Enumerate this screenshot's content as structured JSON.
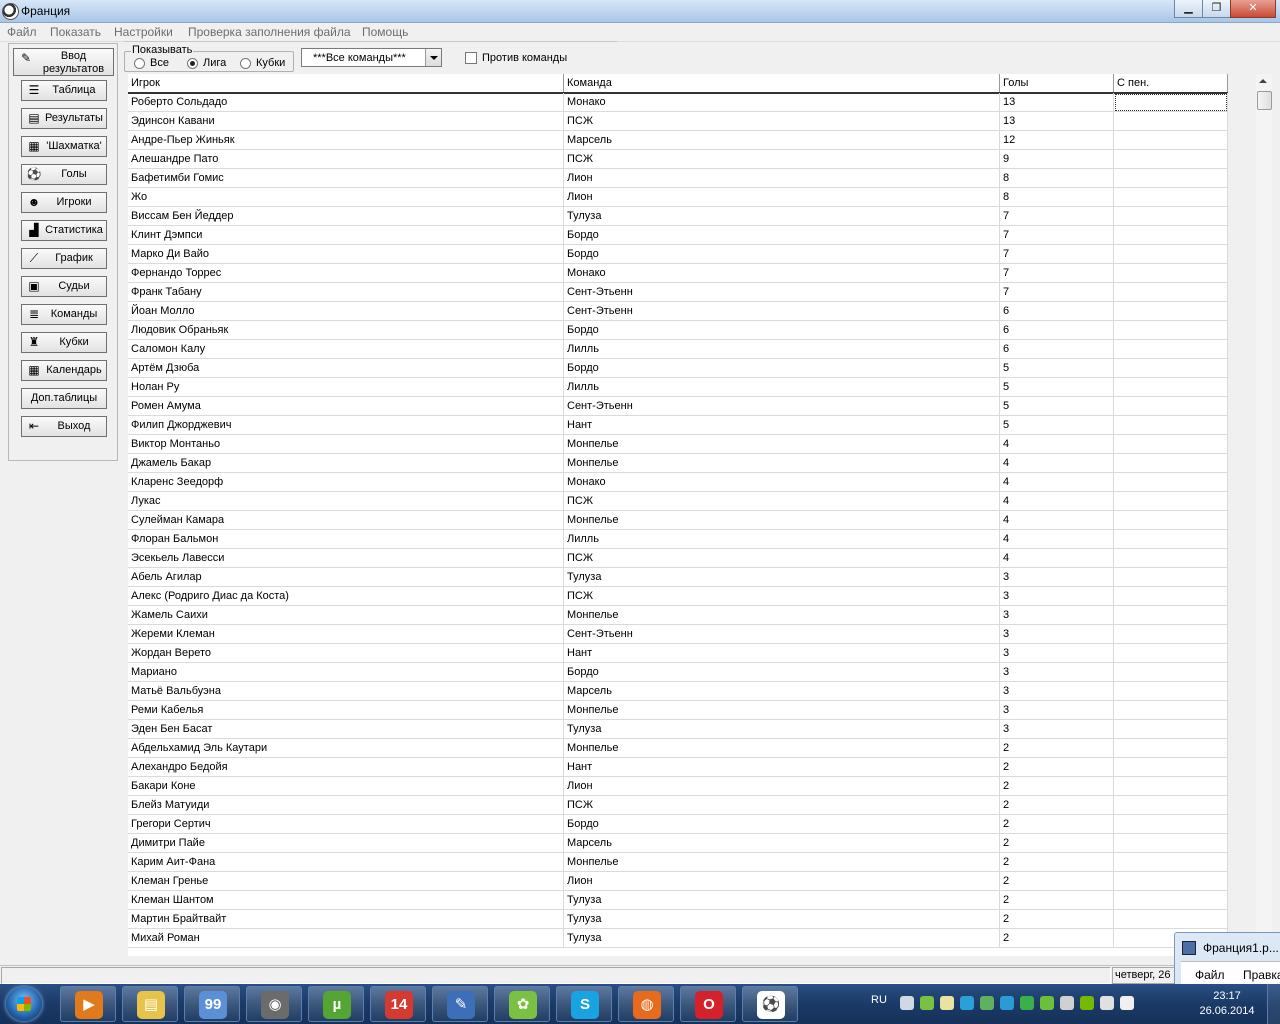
{
  "window": {
    "title": "Франция",
    "controls": {
      "minimize": "▁",
      "maximize": "❐",
      "close": "✕"
    }
  },
  "menu": [
    "Файл",
    "Показать",
    "Настройки",
    "Проверка заполнения файла",
    "Помощь"
  ],
  "nav": [
    {
      "label": "Ввод результатов",
      "icon": "edit-icon"
    },
    {
      "label": "Таблица",
      "icon": "list-icon"
    },
    {
      "label": "Результаты",
      "icon": "results-icon"
    },
    {
      "label": "'Шахматка'",
      "icon": "chess-grid-icon"
    },
    {
      "label": "Голы",
      "icon": "ball-icon"
    },
    {
      "label": "Игроки",
      "icon": "player-icon"
    },
    {
      "label": "Статистика",
      "icon": "stats-icon"
    },
    {
      "label": "График",
      "icon": "graph-icon"
    },
    {
      "label": "Судьи",
      "icon": "referee-icon"
    },
    {
      "label": "Команды",
      "icon": "teams-icon"
    },
    {
      "label": "Кубки",
      "icon": "cup-icon"
    },
    {
      "label": "Календарь",
      "icon": "calendar-icon"
    },
    {
      "label": "Доп.таблицы",
      "icon": ""
    },
    {
      "label": "Выход",
      "icon": "exit-icon"
    }
  ],
  "filter": {
    "group_label": "Показывать",
    "options": [
      {
        "label": "Все",
        "selected": false
      },
      {
        "label": "Лига",
        "selected": true
      },
      {
        "label": "Кубки",
        "selected": false
      }
    ],
    "team_select": "***Все команды***",
    "vs_team_label": "Против команды",
    "vs_team_checked": false
  },
  "grid": {
    "columns": [
      "Игрок",
      "Команда",
      "Голы",
      "С пен."
    ],
    "rows": [
      [
        "Роберто Сольдадо",
        "Монако",
        "13",
        ""
      ],
      [
        "Эдинсон Кавани",
        "ПСЖ",
        "13",
        ""
      ],
      [
        "Андре-Пьер Жиньяк",
        "Марсель",
        "12",
        ""
      ],
      [
        "Алешандре Пато",
        "ПСЖ",
        "9",
        ""
      ],
      [
        "Бафетимби Гомис",
        "Лион",
        "8",
        ""
      ],
      [
        "Жо",
        "Лион",
        "8",
        ""
      ],
      [
        "Виссам Бен Йеддер",
        "Тулуза",
        "7",
        ""
      ],
      [
        "Клинт Дэмпси",
        "Бордо",
        "7",
        ""
      ],
      [
        "Марко Ди Вайо",
        "Бордо",
        "7",
        ""
      ],
      [
        "Фернандо Торрес",
        "Монако",
        "7",
        ""
      ],
      [
        "Франк Табану",
        "Сент-Этьенн",
        "7",
        ""
      ],
      [
        "Йоан Молло",
        "Сент-Этьенн",
        "6",
        ""
      ],
      [
        "Людовик Обраньяк",
        "Бордо",
        "6",
        ""
      ],
      [
        "Саломон Калу",
        "Лилль",
        "6",
        ""
      ],
      [
        "Артём Дзюба",
        "Бордо",
        "5",
        ""
      ],
      [
        "Нолан Ру",
        "Лилль",
        "5",
        ""
      ],
      [
        "Ромен Амума",
        "Сент-Этьенн",
        "5",
        ""
      ],
      [
        "Филип Джорджевич",
        "Нант",
        "5",
        ""
      ],
      [
        "Виктор Монтаньо",
        "Монпелье",
        "4",
        ""
      ],
      [
        "Джамель Бакар",
        "Монпелье",
        "4",
        ""
      ],
      [
        "Кларенс Зеедорф",
        "Монако",
        "4",
        ""
      ],
      [
        "Лукас",
        "ПСЖ",
        "4",
        ""
      ],
      [
        "Сулейман Камара",
        "Монпелье",
        "4",
        ""
      ],
      [
        "Флоран Бальмон",
        "Лилль",
        "4",
        ""
      ],
      [
        "Эсекьель Лавесси",
        "ПСЖ",
        "4",
        ""
      ],
      [
        "Абель Агилар",
        "Тулуза",
        "3",
        ""
      ],
      [
        "Алекс (Родриго Диас да Коста)",
        "ПСЖ",
        "3",
        ""
      ],
      [
        "Жамель Саихи",
        "Монпелье",
        "3",
        ""
      ],
      [
        "Жереми Клеман",
        "Сент-Этьенн",
        "3",
        ""
      ],
      [
        "Жордан Верето",
        "Нант",
        "3",
        ""
      ],
      [
        "Мариано",
        "Бордо",
        "3",
        ""
      ],
      [
        "Матьё Вальбуэна",
        "Марсель",
        "3",
        ""
      ],
      [
        "Реми Кабелья",
        "Монпелье",
        "3",
        ""
      ],
      [
        "Эден Бен Басат",
        "Тулуза",
        "3",
        ""
      ],
      [
        "Абдельхамид Эль Каутари",
        "Монпелье",
        "2",
        ""
      ],
      [
        "Алехандро Бедойя",
        "Нант",
        "2",
        ""
      ],
      [
        "Бакари Коне",
        "Лион",
        "2",
        ""
      ],
      [
        "Блейз Матуиди",
        "ПСЖ",
        "2",
        ""
      ],
      [
        "Грегори Сертич",
        "Бордо",
        "2",
        ""
      ],
      [
        "Димитри Пайе",
        "Марсель",
        "2",
        ""
      ],
      [
        "Карим Аит-Фана",
        "Монпелье",
        "2",
        ""
      ],
      [
        "Клеман Гренье",
        "Лион",
        "2",
        ""
      ],
      [
        "Клеман Шантом",
        "Тулуза",
        "2",
        ""
      ],
      [
        "Мартин Брайтвайт",
        "Тулуза",
        "2",
        ""
      ],
      [
        "Михай Роман",
        "Тулуза",
        "2",
        ""
      ]
    ]
  },
  "status": {
    "date": "четверг, 26"
  },
  "popup": {
    "title": "Франция1.р...",
    "menu": [
      "Файл",
      "Правка"
    ]
  },
  "taskbar": {
    "apps": [
      {
        "name": "media-player",
        "color": "#e07a1a",
        "glyph": "▶"
      },
      {
        "name": "explorer",
        "color": "#e8c34a",
        "glyph": "▤"
      },
      {
        "name": "monitor",
        "color": "#5b8fd6",
        "glyph": "99"
      },
      {
        "name": "camera",
        "color": "#6b6b6b",
        "glyph": "◉"
      },
      {
        "name": "utorrent",
        "color": "#55a532",
        "glyph": "µ"
      },
      {
        "name": "app-14",
        "color": "#d43a2f",
        "glyph": "14"
      },
      {
        "name": "pen-app",
        "color": "#3d6fb8",
        "glyph": "✎"
      },
      {
        "name": "icq",
        "color": "#7ac143",
        "glyph": "✿"
      },
      {
        "name": "skype",
        "color": "#1aa3e3",
        "glyph": "S"
      },
      {
        "name": "firefox",
        "color": "#e86a1c",
        "glyph": "◍"
      },
      {
        "name": "opera",
        "color": "#d6202a",
        "glyph": "O"
      },
      {
        "name": "football-app",
        "color": "#ffffff",
        "glyph": "⚽"
      }
    ],
    "lang": "RU",
    "time": "23:17",
    "date": "26.06.2014"
  }
}
